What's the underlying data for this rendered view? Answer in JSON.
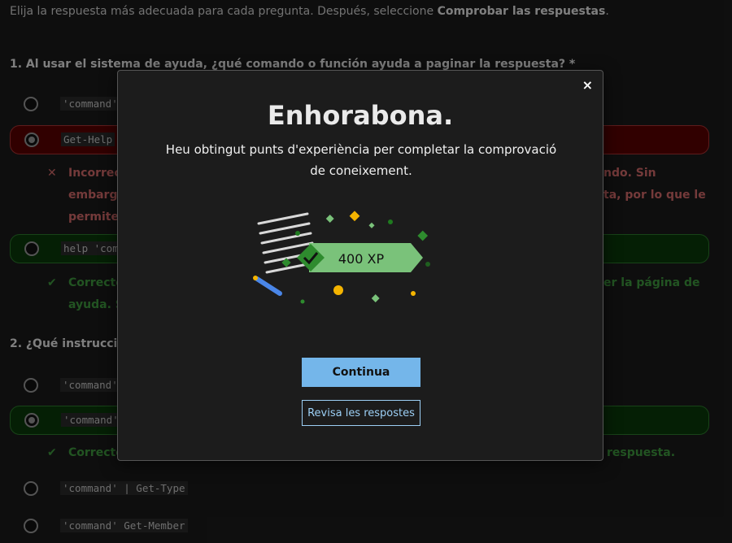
{
  "intro": {
    "text_plain": "Elija la respuesta más adecuada para cada pregunta. Después, seleccione ",
    "text_bold": "Comprobar las respuestas",
    "text_end": "."
  },
  "q1": {
    "title": "1. Al usar el sistema de ayuda, ¿qué comando o función ayuda a paginar la respuesta? *",
    "opt1": "'command'",
    "opt2": "Get-Help",
    "fb_wrong_l1": "Incorrec",
    "fb_wrong_l1_tail": "ndo. Sin",
    "fb_wrong_l2": "embarge",
    "fb_wrong_l2_tail": "ta, por lo que le",
    "fb_wrong_l3": "permite",
    "opt3": "help 'com",
    "fb_right_l1": "Correcto",
    "fb_right_l1_tail": "er la página de",
    "fb_right_l2": "ayuda. S"
  },
  "q2": {
    "title": "2. ¿Qué instrucció",
    "opt1": "'command'",
    "opt2": "'command'",
    "fb_right": "Correcto",
    "fb_right_tail": "respuesta.",
    "opt3": "'command' | Get-Type",
    "opt4": "'command' Get-Member"
  },
  "modal": {
    "close": "×",
    "title": "Enhorabona.",
    "text": "Heu obtingut punts d'experiència per completar la comprovació de coneixement.",
    "xp": "400 XP",
    "primary": "Continua",
    "secondary": "Revisa les respostes"
  }
}
